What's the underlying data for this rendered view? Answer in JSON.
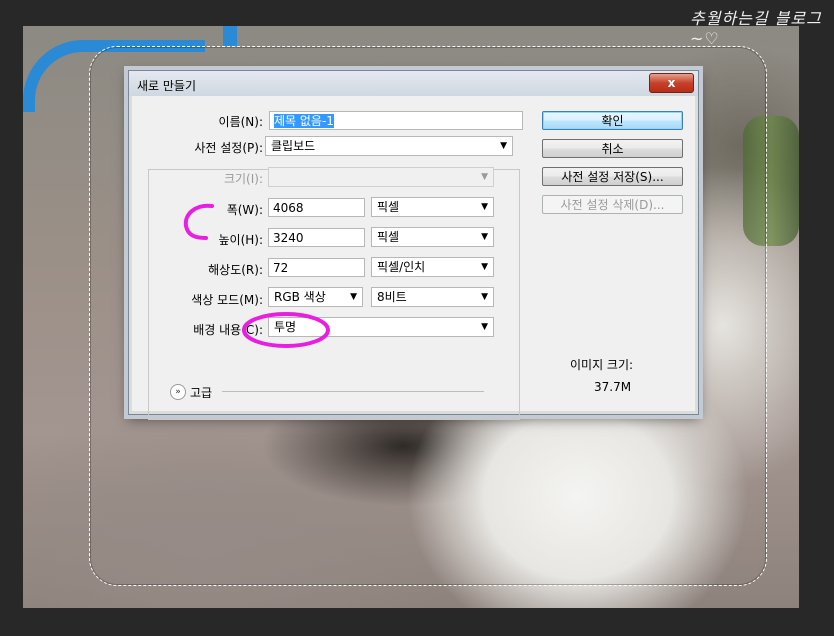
{
  "watermark": "추월하는길 블로그~♡",
  "dialog": {
    "title": "새로 만들기",
    "close_label": "x",
    "fields": {
      "name_label": "이름(N):",
      "name_value": "제목 없음-1",
      "preset_label": "사전 설정(P):",
      "preset_value": "클립보드",
      "size_label": "크기(I):",
      "size_value": "",
      "width_label": "폭(W):",
      "width_value": "4068",
      "width_unit": "픽셀",
      "height_label": "높이(H):",
      "height_value": "3240",
      "height_unit": "픽셀",
      "resolution_label": "해상도(R):",
      "resolution_value": "72",
      "resolution_unit": "픽셀/인치",
      "color_mode_label": "색상 모드(M):",
      "color_mode_value": "RGB 색상",
      "bit_depth_value": "8비트",
      "background_label": "배경 내용(C):",
      "background_value": "투명"
    },
    "buttons": {
      "ok": "확인",
      "cancel": "취소",
      "save_preset": "사전 설정 저장(S)...",
      "delete_preset": "사전 설정 삭제(D)..."
    },
    "image_size_label": "이미지 크기:",
    "image_size_value": "37.7M",
    "advanced_label": "고급"
  },
  "colors": {
    "annotation": "#e81ee0",
    "accent_pipe": "#2b8ad6"
  }
}
